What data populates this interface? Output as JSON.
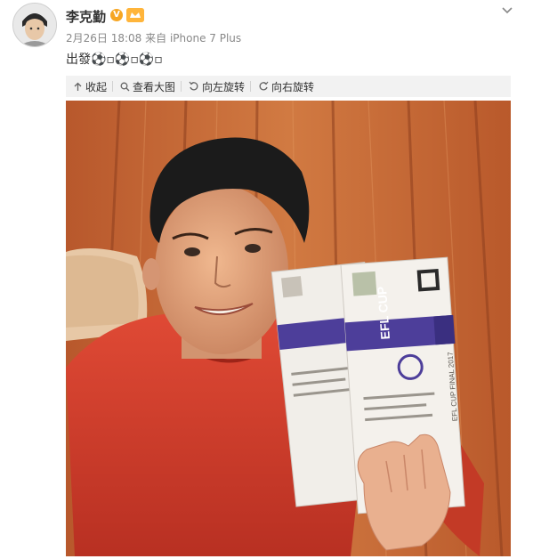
{
  "post": {
    "author": "李克勤",
    "time": "2月26日 18:08",
    "source": "来自 iPhone 7 Plus",
    "text": "出發⚽▫⚽▫⚽▫"
  },
  "toolbar": {
    "collapse": "收起",
    "view_large": "查看大图",
    "rotate_left": "向左旋转",
    "rotate_right": "向右旋转"
  },
  "photo": {
    "ticket_brand": "EFL CUP",
    "ticket_subtitle": "EFL CUP FINAL 2017"
  },
  "colors": {
    "accent": "#f6a623",
    "toolbar_bg": "#f2f2f2",
    "text_muted": "#888888",
    "sweater_red": "#d8402e",
    "wood": "#c76d3a"
  }
}
